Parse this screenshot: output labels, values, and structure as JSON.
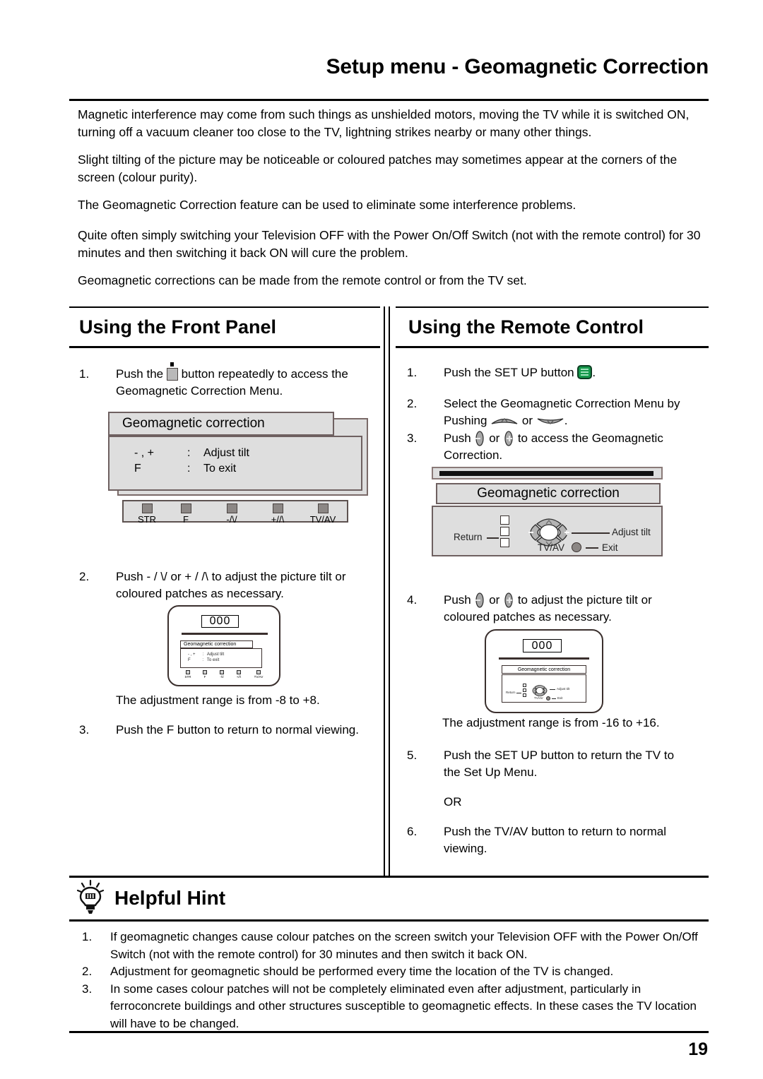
{
  "document": {
    "title": "Setup menu - Geomagnetic Correction",
    "page_number": "19"
  },
  "intro_paragraphs": [
    "Magnetic interference may come from such things as unshielded motors, moving the TV while it is switched ON, turning off a vacuum cleaner too close to the TV, lightning strikes nearby or many other things.",
    "Slight tilting of the picture may be noticeable or coloured patches may sometimes appear at the corners of the screen (colour purity).",
    "The Geomagnetic Correction feature can be used to eliminate some interference problems.",
    "Quite often simply switching your Television OFF with the Power On/Off Switch (not with the remote control) for 30 minutes and then switching it back ON will cure the problem.",
    "Geomagnetic corrections can be made from the remote control or from the TV set."
  ],
  "front_panel": {
    "heading": "Using the Front Panel",
    "step1_num": "1.",
    "step1_text_a": "Push the",
    "step1_text_b": "button repeatedly to access the Geomagnetic Correction Menu.",
    "osd": {
      "title": "Geomagnetic correction",
      "rows": [
        {
          "key": "- , +",
          "colon": ":",
          "action": "Adjust tilt"
        },
        {
          "key": "F",
          "colon": ":",
          "action": "To exit"
        }
      ]
    },
    "buttons": [
      "STR",
      "F",
      "-/\\/",
      "+//\\",
      "TV/AV"
    ],
    "step2_num": "2.",
    "step2_text": "Push - / \\/ or + / /\\ to adjust the picture tilt or coloured patches as necessary.",
    "tv_value": "000",
    "range_text": "The adjustment range is from -8 to +8.",
    "step3_num": "3.",
    "step3_text": "Push the F button to return to normal viewing."
  },
  "remote": {
    "heading": "Using the Remote Control",
    "step1_num": "1.",
    "step1_text_a": "Push the SET UP button",
    "step1_text_b": ".",
    "step2_num": "2.",
    "step2_text_a": "Select the Geomagnetic Correction Menu by Pushing",
    "step2_or": "or",
    "step2_text_b": ".",
    "step3_num": "3.",
    "step3_text_a": "Push",
    "step3_or": "or",
    "step3_text_b": "to access the Geomagnetic Correction.",
    "osd": {
      "title": "Geomagnetic correction",
      "label_return": "Return",
      "label_adjust": "Adjust tilt",
      "label_tvav": "TV/AV",
      "label_exit": "Exit",
      "pad_up": "⌃",
      "pad_down": "⌄",
      "pad_left": "−",
      "pad_right": "+"
    },
    "step4_num": "4.",
    "step4_text_a": "Push",
    "step4_or": "or",
    "step4_text_b": "to adjust the picture tilt or coloured patches as necessary.",
    "tv_value": "000",
    "range_text": "The adjustment range is from -16 to +16.",
    "step5_num": "5.",
    "step5_text": "Push the SET UP button to return the TV to the Set Up Menu.",
    "or_text": "OR",
    "step6_num": "6.",
    "step6_text": "Push the TV/AV button to return to normal viewing."
  },
  "helpful_hint": {
    "title": "Helpful Hint",
    "items": [
      {
        "num": "1.",
        "text": "If geomagnetic changes cause colour patches on the screen switch your Television OFF with the Power On/Off Switch (not with the remote control) for 30 minutes and then switch it back ON."
      },
      {
        "num": "2.",
        "text": "Adjustment for geomagnetic should be performed every time the location of the TV is changed."
      },
      {
        "num": "3.",
        "text": "In some cases colour patches will not be completely eliminated even after adjustment, particularly in ferroconcrete buildings and other structures susceptible to geomagnetic effects. In these cases the TV location will have to be changed."
      }
    ]
  },
  "mini_osd": {
    "title": "Geomagnetic correction",
    "row1": "- , +      :   Adjust tilt",
    "row2": "F          :   To exit",
    "buttons": [
      "STR",
      "F",
      "-/\\/",
      "+//\\",
      "TV/AV"
    ]
  },
  "colors": {
    "osd_fill": "#dedede",
    "osd_border": "#6e6060",
    "setup_green": "#16984b",
    "button_gray": "#8c8785"
  }
}
